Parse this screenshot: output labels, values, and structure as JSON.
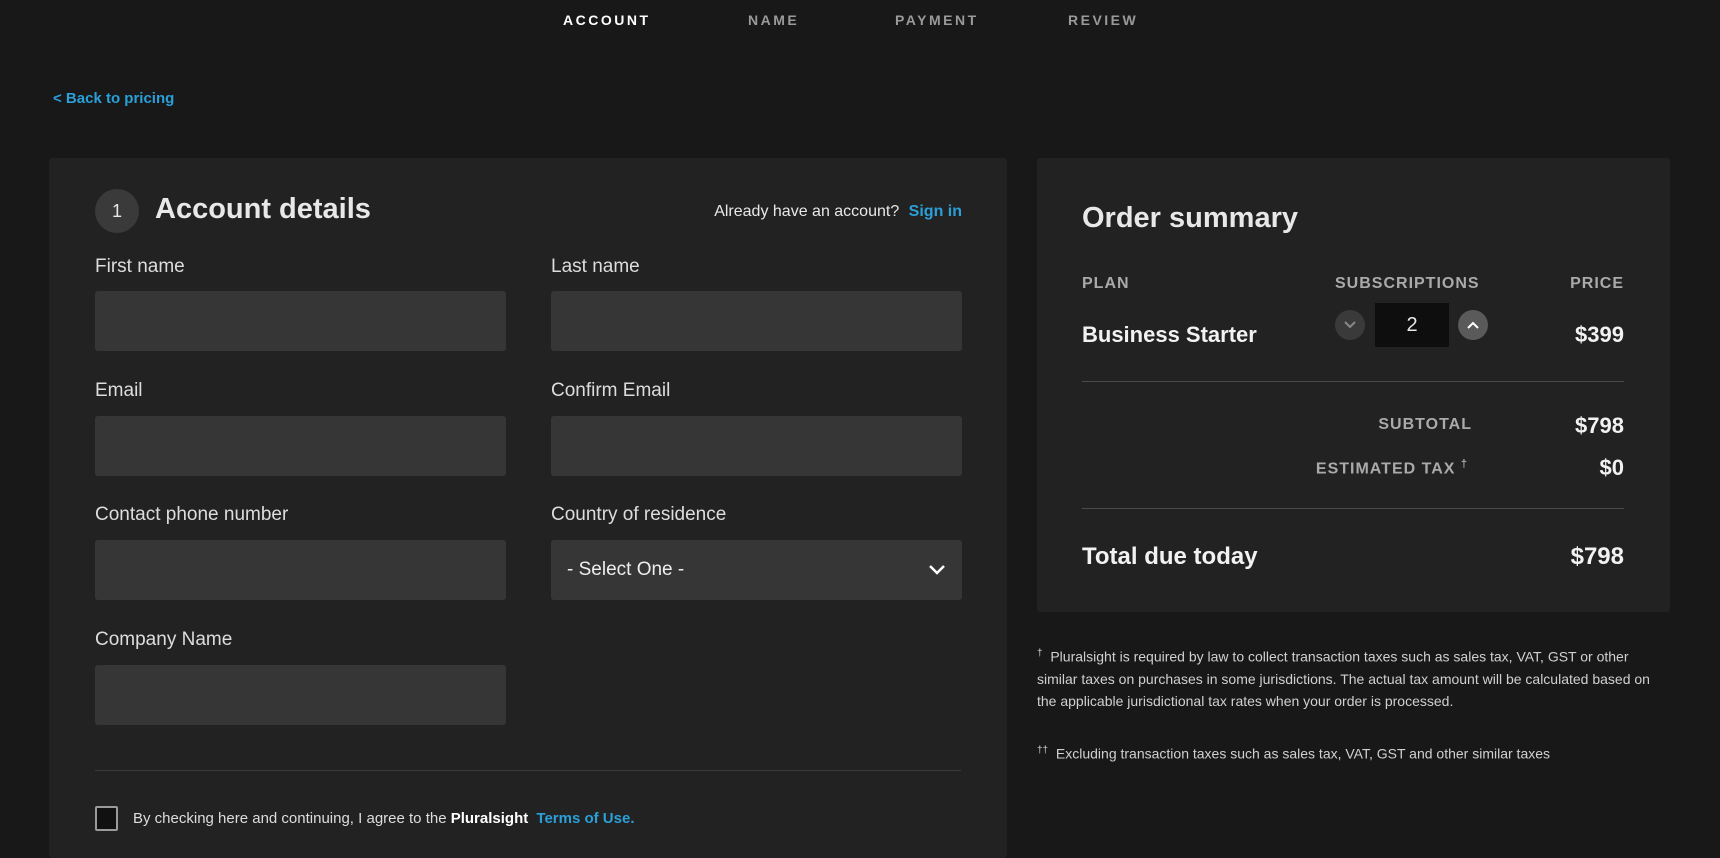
{
  "steps": [
    "ACCOUNT",
    "NAME",
    "PAYMENT",
    "REVIEW"
  ],
  "back_link": "< Back to pricing",
  "account": {
    "step_number": "1",
    "title": "Account details",
    "already": "Already have an account?",
    "sign_in": "Sign in",
    "fields": {
      "first_name": "First name",
      "last_name": "Last name",
      "email": "Email",
      "confirm_email": "Confirm Email",
      "phone": "Contact phone number",
      "country": "Country of residence",
      "company": "Company Name"
    },
    "country_value": "- Select One -",
    "terms_text": "By checking here and continuing, I agree to the",
    "terms_brand": "Pluralsight",
    "terms_link": "Terms of Use."
  },
  "order": {
    "title": "Order summary",
    "col_plan": "PLAN",
    "col_subs": "SUBSCRIPTIONS",
    "col_price": "PRICE",
    "plan": "Business Starter",
    "quantity": "2",
    "price": "$399",
    "subtotal_label": "SUBTOTAL",
    "subtotal": "$798",
    "tax_label": "ESTIMATED TAX",
    "tax_mark": "†",
    "tax": "$0",
    "total_label": "Total due today",
    "total": "$798"
  },
  "footnotes": [
    {
      "mark": "†",
      "text": "Pluralsight is required by law to collect transaction taxes such as sales tax, VAT, GST or other similar taxes on purchases in some jurisdictions. The actual tax amount will be calculated based on the applicable jurisdictional tax rates when your order is processed."
    },
    {
      "mark": "††",
      "text": "Excluding transaction taxes such as sales tax, VAT, GST and other similar taxes"
    }
  ],
  "colors": {
    "bg": "#181818",
    "panel": "#222222",
    "input": "#363636",
    "link": "#2a9fd8"
  }
}
